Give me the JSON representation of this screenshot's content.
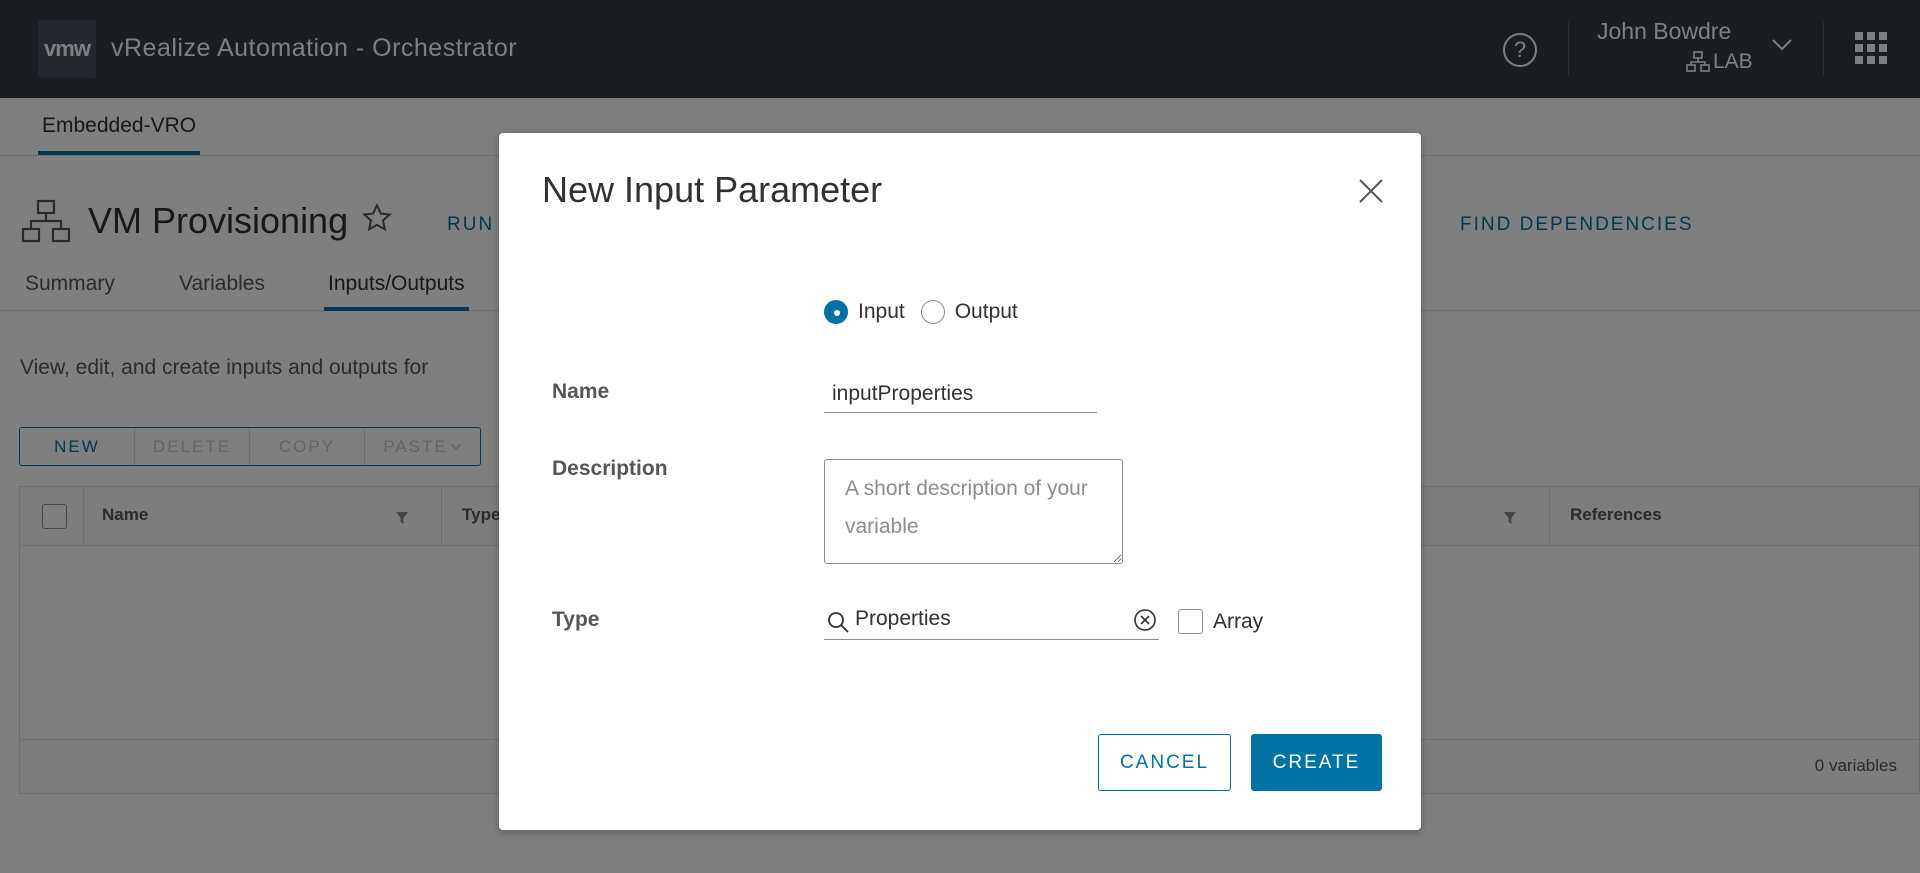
{
  "header": {
    "logo_text": "vmw",
    "title": "vRealize Automation - Orchestrator",
    "help_glyph": "?",
    "user_name": "John Bowdre",
    "user_org": "LAB"
  },
  "top_tabs": [
    {
      "label": "Embedded-VRO"
    }
  ],
  "workflow": {
    "title": "VM Provisioning",
    "actions": {
      "run": "RUN",
      "find_dependencies": "FIND DEPENDENCIES"
    },
    "tabs": [
      {
        "label": "Summary"
      },
      {
        "label": "Variables"
      },
      {
        "label": "Inputs/Outputs"
      }
    ],
    "description": "View, edit, and create inputs and outputs for",
    "toolbar": {
      "new": "NEW",
      "delete": "DELETE",
      "copy": "COPY",
      "paste": "PASTE"
    },
    "grid": {
      "columns": [
        {
          "label": "Name"
        },
        {
          "label": "Type"
        },
        {
          "label": "References"
        }
      ],
      "footer": "0 variables"
    }
  },
  "modal": {
    "title": "New Input Parameter",
    "direction": {
      "input_label": "Input",
      "output_label": "Output",
      "selected": "Input"
    },
    "name": {
      "label": "Name",
      "value": "inputProperties"
    },
    "description": {
      "label": "Description",
      "placeholder": "A short description of your variable"
    },
    "type": {
      "label": "Type",
      "value": "Properties",
      "array_label": "Array",
      "array_checked": false
    },
    "buttons": {
      "cancel": "CANCEL",
      "create": "CREATE"
    }
  },
  "colors": {
    "header_bg": "#313c45",
    "accent": "#0072a3",
    "backdrop": "rgba(0,0,0,0.5)"
  },
  "icons": [
    "vmw-logo",
    "help-icon",
    "org-icon",
    "chevron-down-icon",
    "apps-grid-icon",
    "workflow-icon",
    "star-icon",
    "filter-icon",
    "close-icon",
    "search-icon",
    "clear-icon"
  ]
}
